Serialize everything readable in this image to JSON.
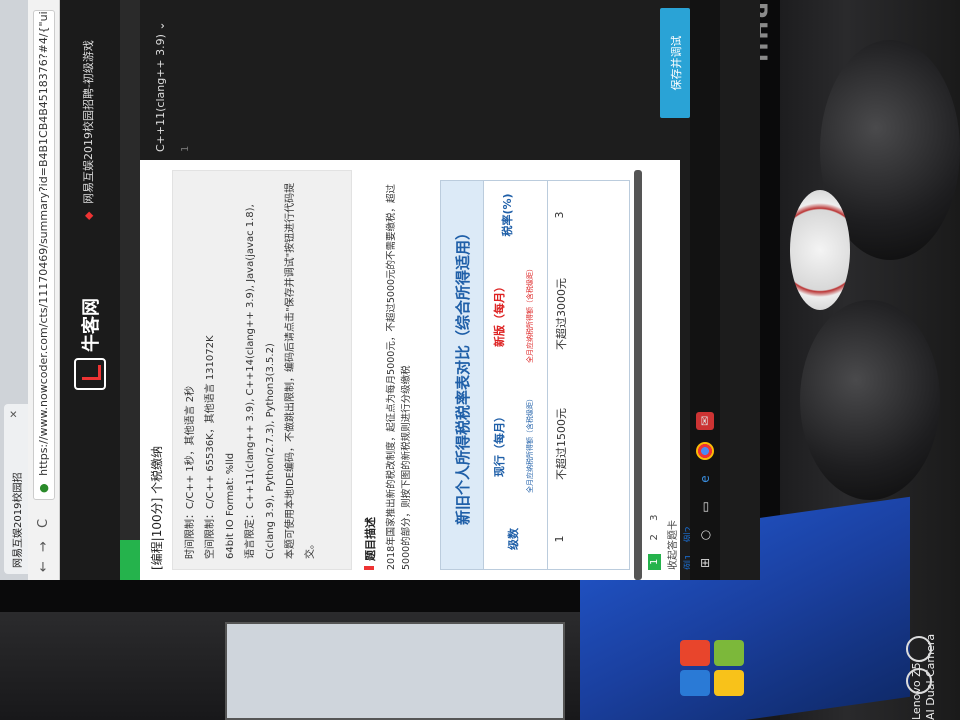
{
  "browser": {
    "tab_title": "网易互娱2019校园招",
    "url": "https://www.nowcoder.com/cts/11170469/summary?id=B4B1CB4B4518376?#4/{\"uid",
    "back": "←",
    "forward": "→",
    "reload": "C"
  },
  "site": {
    "logo_text": "牛客网",
    "banner": "网易互娱2019校园招聘-初级游戏"
  },
  "problem": {
    "title": "[编程|100分] 个税缴纳",
    "limits": [
      "时间限制：C/C++ 1秒，其他语言 2秒",
      "空间限制：C/C++ 65536K，其他语言 131072K",
      "64bit IO Format: %lld",
      "语言限定：C++11(clang++ 3.9), C++14(clang++ 3.9), Java(javac 1.8), C(clang 3.9), Python(2.7.3), Python3(3.5.2)",
      "本题可使用本地IDE编码，不做跳出限制，编码后请点击\"保存并调试\"按钮进行代码提交。"
    ],
    "section_title": "题目描述",
    "desc": "2018年国家推出新的税改制度，起征点为每月5000元，不超过5000元的不需要缴税，超过5000的部分，则按下图的新税规则进行分级缴税"
  },
  "tax_table": {
    "title": "新旧个人所得税税率表对比（综合所得适用）",
    "col_level": "级数",
    "col_old": "现行（每月）",
    "col_old_sub": "全月应纳税所得额（含税级距）",
    "col_new": "新版（每月）",
    "col_new_sub": "全月应纳税所得额（含税级距）",
    "col_rate": "税率(%)",
    "rows": [
      {
        "level": "1",
        "old": "不超过1500元",
        "new": "不超过3000元",
        "rate": "3"
      }
    ]
  },
  "pager": {
    "pages": [
      "1",
      "2",
      "3"
    ],
    "current": "1",
    "collapse": "收起答题卡",
    "examples": [
      "例1",
      "例2"
    ]
  },
  "ide": {
    "language": "C++11(clang++ 3.9)",
    "line": "1",
    "save_button": "保存并调试"
  },
  "environment": {
    "monitor_brand": "PHIL",
    "watermark_line1": "Lenovo Z5",
    "watermark_line2": "AI Dual Camera"
  }
}
